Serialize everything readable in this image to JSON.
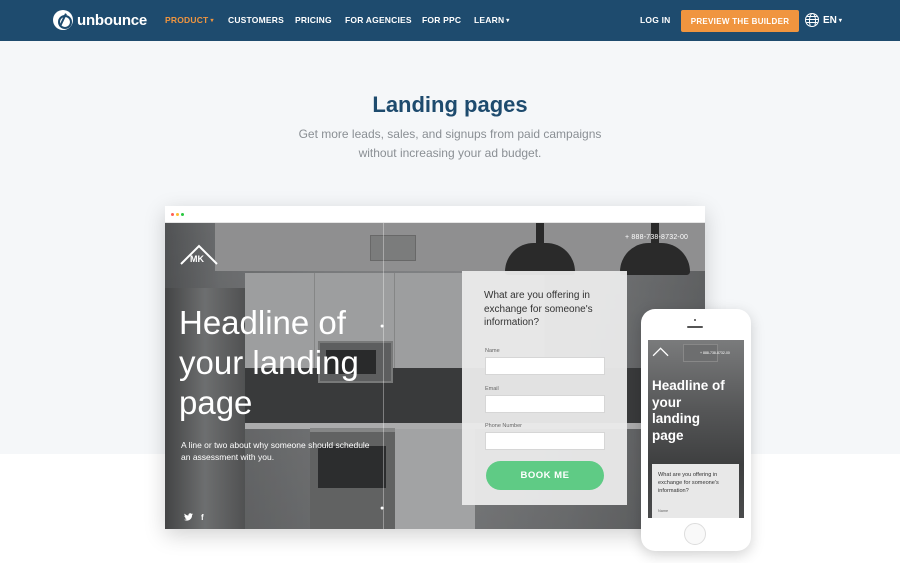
{
  "nav": {
    "brand": "unbounce",
    "items": [
      {
        "label": "PRODUCT",
        "has_caret": true,
        "active": true
      },
      {
        "label": "CUSTOMERS",
        "has_caret": false,
        "active": false
      },
      {
        "label": "PRICING",
        "has_caret": false,
        "active": false
      },
      {
        "label": "FOR AGENCIES",
        "has_caret": false,
        "active": false
      },
      {
        "label": "FOR PPC",
        "has_caret": false,
        "active": false
      },
      {
        "label": "LEARN",
        "has_caret": true,
        "active": false
      }
    ],
    "login": "LOG IN",
    "cta": "PREVIEW THE BUILDER",
    "language": "EN",
    "caret": "▾"
  },
  "hero": {
    "title": "Landing pages",
    "subtitle": "Get more leads, sales, and signups from paid campaigns without increasing your ad budget."
  },
  "desktop_mock": {
    "window_dots": [
      "#ff5f57",
      "#febc2e",
      "#28c840"
    ],
    "logo_text": "MK",
    "phone_number": "+ 888-738-8732-00",
    "headline": "Headline of your landing page",
    "description": "A line or two about why someone should schedule an assessment with you.",
    "social": {
      "twitter": "🐦",
      "facebook": "f"
    },
    "form": {
      "question": "What are you offering in exchange for someone's information?",
      "fields": [
        {
          "label": "Name",
          "value": ""
        },
        {
          "label": "Email",
          "value": ""
        },
        {
          "label": "Phone Number",
          "value": ""
        }
      ],
      "submit": "BOOK ME"
    }
  },
  "mobile_mock": {
    "logo_text": "MK",
    "phone_number": "+ 888-738-8732-00",
    "headline": "Headline of your landing page",
    "form_question": "What are you offering in exchange for someone's information?",
    "first_field_label": "Name"
  },
  "colors": {
    "nav_bg": "#1e4b6e",
    "accent_orange": "#f0953f",
    "title_blue": "#1e4b6e",
    "button_green": "#5fcb85"
  }
}
